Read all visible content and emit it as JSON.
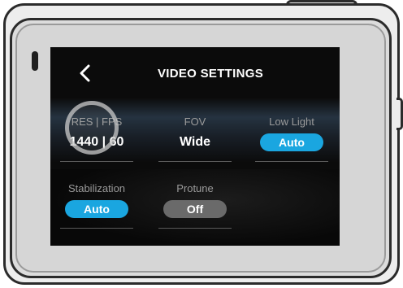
{
  "screen": {
    "title": "VIDEO SETTINGS",
    "back_icon": "chevron-left-icon"
  },
  "settings": [
    {
      "label": "RES | FPS",
      "value": "1440 | 60",
      "style": "text"
    },
    {
      "label": "FOV",
      "value": "Wide",
      "style": "text"
    },
    {
      "label": "Low Light",
      "value": "Auto",
      "style": "pill-on"
    },
    {
      "label": "Stabilization",
      "value": "Auto",
      "style": "pill-on"
    },
    {
      "label": "Protune",
      "value": "Off",
      "style": "pill-off"
    }
  ],
  "colors": {
    "accent": "#1aa6e0",
    "off_pill": "#6a6a6a",
    "screen_bg": "#0b0b0b",
    "camera_body": "#ededed"
  }
}
